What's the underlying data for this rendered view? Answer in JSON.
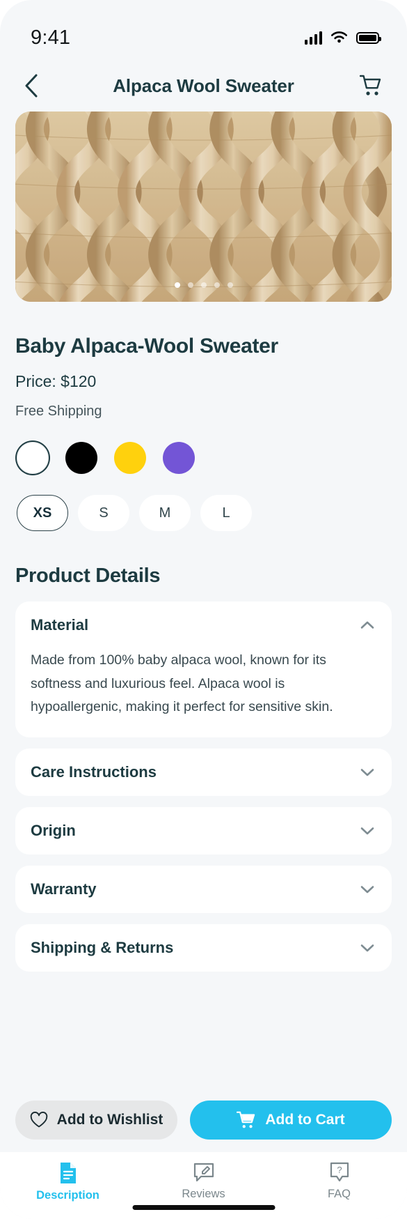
{
  "status_bar": {
    "time": "9:41",
    "signal_icon": "cellular-signal-icon",
    "wifi_icon": "wifi-icon",
    "battery_icon": "battery-icon"
  },
  "navbar": {
    "back_icon": "chevron-left-icon",
    "title": "Alpaca Wool Sweater",
    "cart_icon": "shopping-cart-icon"
  },
  "gallery": {
    "image_alt": "knitted cream alpaca wool cable texture",
    "dot_count": 5,
    "active_dot": 1
  },
  "product": {
    "title": "Baby Alpaca-Wool Sweater",
    "price": "Price: $120",
    "shipping": "Free Shipping",
    "colors": [
      {
        "name": "white",
        "hex": "#ffffff",
        "selected": true
      },
      {
        "name": "black",
        "hex": "#000000",
        "selected": false
      },
      {
        "name": "yellow",
        "hex": "#ffd10d",
        "selected": false
      },
      {
        "name": "purple",
        "hex": "#7355d6",
        "selected": false
      }
    ],
    "sizes": [
      {
        "label": "XS",
        "selected": true
      },
      {
        "label": "S",
        "selected": false
      },
      {
        "label": "M",
        "selected": false
      },
      {
        "label": "L",
        "selected": false
      }
    ]
  },
  "details": {
    "heading": "Product Details",
    "sections": [
      {
        "title": "Material",
        "expanded": true,
        "chevron": "chevron-up-icon",
        "body": "Made from 100% baby alpaca wool, known for its softness and luxurious feel. Alpaca wool is hypoallergenic, making it perfect for sensitive skin."
      },
      {
        "title": "Care Instructions",
        "expanded": false,
        "chevron": "chevron-down-icon",
        "body": ""
      },
      {
        "title": "Origin",
        "expanded": false,
        "chevron": "chevron-down-icon",
        "body": ""
      },
      {
        "title": "Warranty",
        "expanded": false,
        "chevron": "chevron-down-icon",
        "body": ""
      },
      {
        "title": "Shipping & Returns",
        "expanded": false,
        "chevron": "chevron-down-icon",
        "body": ""
      }
    ]
  },
  "actions": {
    "wishlist_label": "Add to Wishlist",
    "wishlist_icon": "heart-outline-icon",
    "cart_label": "Add to Cart",
    "cart_icon": "shopping-cart-icon"
  },
  "tabs": [
    {
      "label": "Description",
      "icon": "document-icon",
      "active": true
    },
    {
      "label": "Reviews",
      "icon": "review-pencil-icon",
      "active": false
    },
    {
      "label": "FAQ",
      "icon": "question-bubble-icon",
      "active": false
    }
  ],
  "colors_theme": {
    "accent": "#23c0ed",
    "ink": "#1d3b41",
    "page_bg": "#f5f7f9",
    "card_bg": "#ffffff",
    "muted": "#7b878c"
  }
}
